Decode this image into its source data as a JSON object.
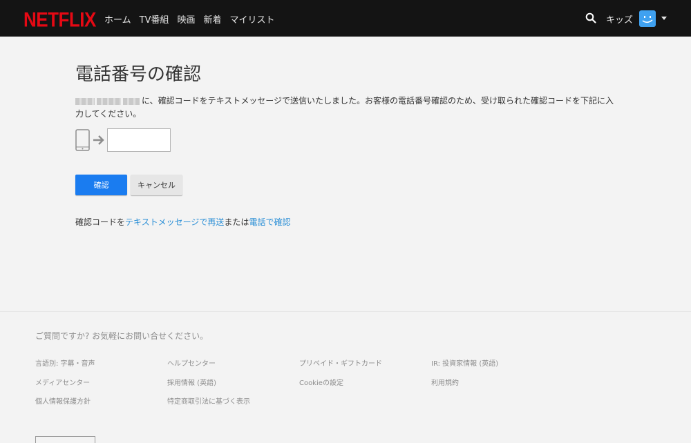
{
  "header": {
    "logo": "NETFLIX",
    "nav": [
      "ホーム",
      "TV番組",
      "映画",
      "新着",
      "マイリスト"
    ],
    "kids": "キッズ"
  },
  "main": {
    "title": "電話番号の確認",
    "description": "に、確認コードをテキストメッセージで送信いたしました。お客様の電話番号確認のため、受け取られた確認コードを下記に入力してください。",
    "code_input_value": "",
    "confirm_button": "確認",
    "cancel_button": "キャンセル",
    "resend_prefix": "確認コードを",
    "resend_link": "テキストメッセージで再送",
    "resend_middle": "または",
    "call_link": "電話で確認"
  },
  "footer": {
    "question": "ご質問ですか? お気軽にお問い合せください。",
    "links": [
      [
        "言語別: 字幕・音声",
        "ヘルプセンター",
        "プリペイド・ギフトカード",
        "IR: 投資家情報 (英語)"
      ],
      [
        "メディアセンター",
        "採用情報 (英語)",
        "Cookieの設定",
        "利用規約"
      ],
      [
        "個人情報保護方針",
        "特定商取引法に基づく表示"
      ]
    ]
  },
  "colors": {
    "brand": "#e50914",
    "header_bg": "#141414",
    "primary_button": "#1a7cf0",
    "link": "#2b8fd6"
  }
}
